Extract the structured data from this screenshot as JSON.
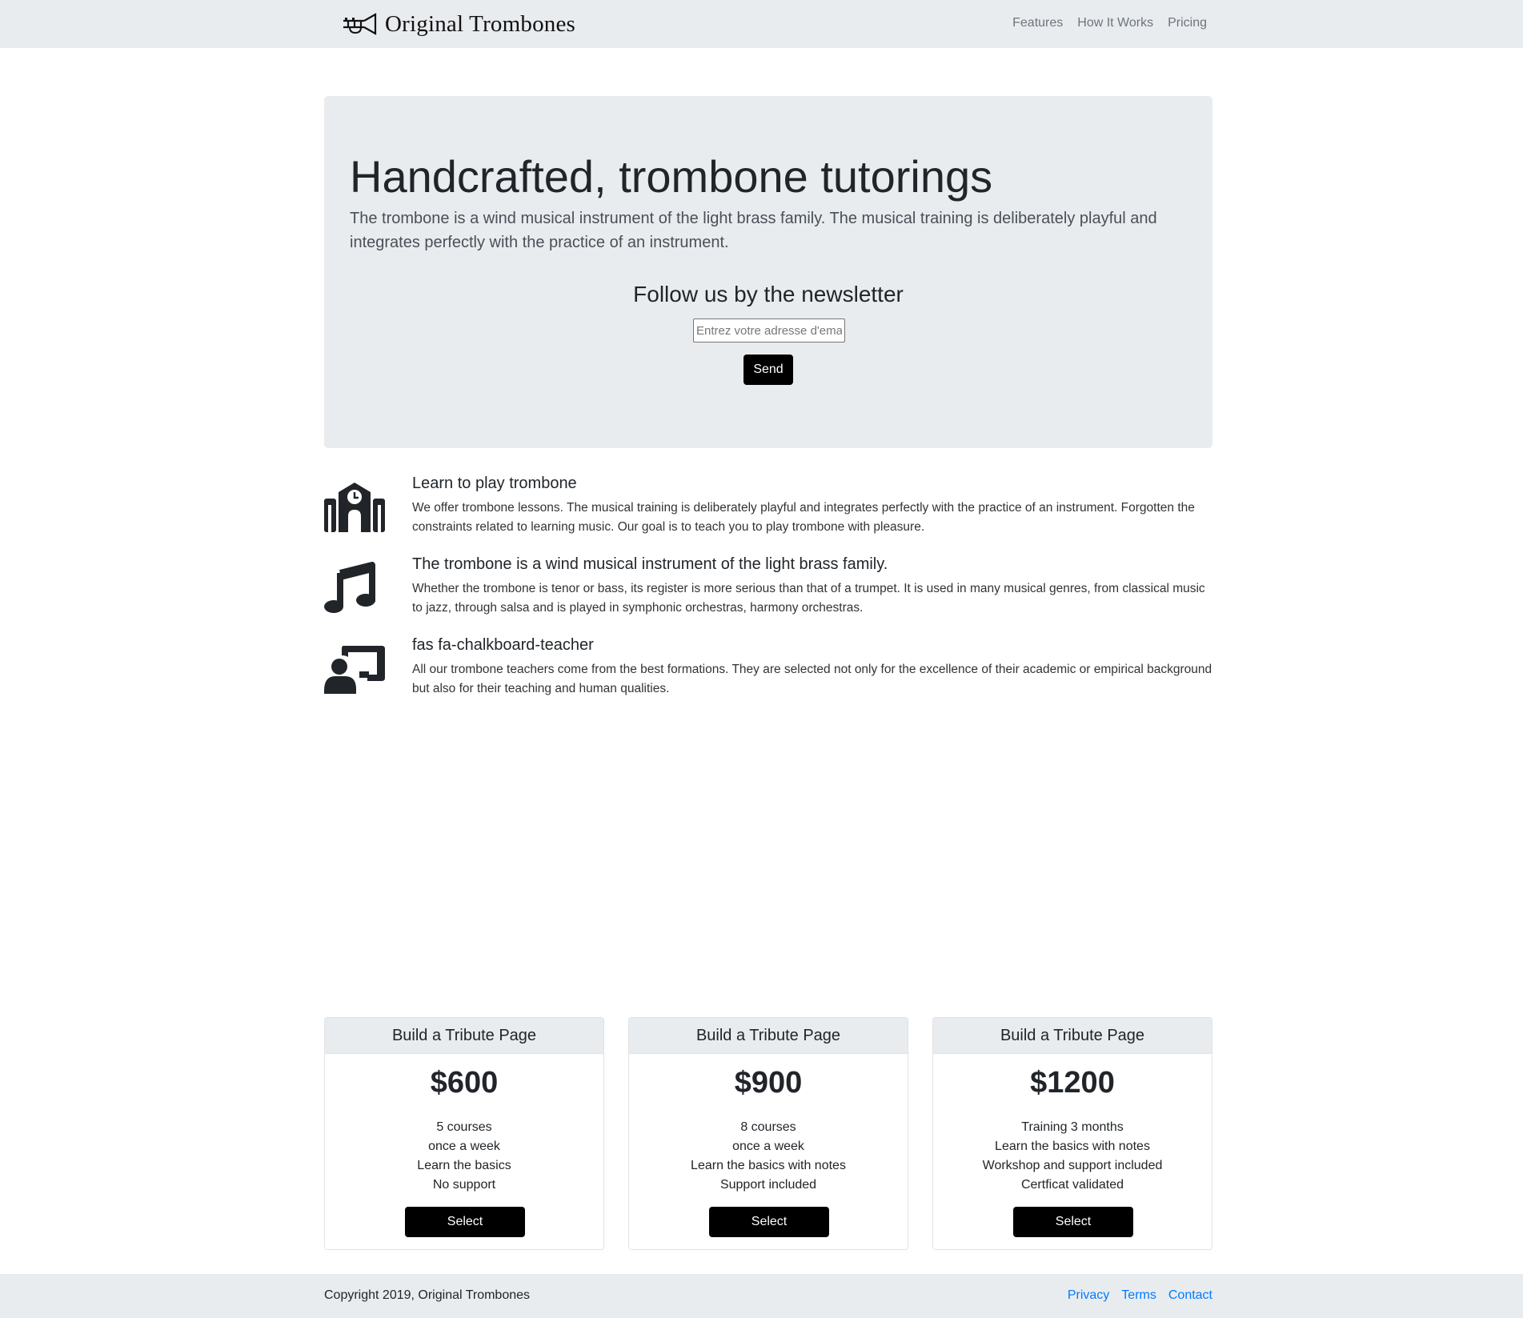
{
  "header": {
    "brand": "Original Trombones",
    "nav": [
      "Features",
      "How It Works",
      "Pricing"
    ]
  },
  "hero": {
    "title": "Handcrafted, trombone tutorings",
    "lead": "The trombone is a wind musical instrument of the light brass family. The musical training is deliberately playful and integrates perfectly with the practice of an instrument.",
    "newsletter_title": "Follow us by the newsletter",
    "email_placeholder": "Entrez votre adresse d'email",
    "send_label": "Send"
  },
  "features": [
    {
      "icon": "school-icon",
      "title": "Learn to play trombone",
      "text": "We offer trombone lessons. The musical training is deliberately playful and integrates perfectly with the practice of an instrument. Forgotten the constraints related to learning music. Our goal is to teach you to play trombone with pleasure."
    },
    {
      "icon": "music-note-icon",
      "title": "The trombone is a wind musical instrument of the light brass family.",
      "text": "Whether the trombone is tenor or bass, its register is more serious than that of a trumpet. It is used in many musical genres, from classical music to jazz, through salsa and is played in symphonic orchestras, harmony orchestras."
    },
    {
      "icon": "chalkboard-teacher-icon",
      "title": "fas fa-chalkboard-teacher",
      "text": "All our trombone teachers come from the best formations. They are selected not only for the excellence of their academic or empirical background but also for their teaching and human qualities."
    }
  ],
  "pricing": [
    {
      "header": "Build a Tribute Page",
      "price": "$600",
      "items": [
        "5 courses",
        "once a week",
        "Learn the basics",
        "No support"
      ],
      "button": "Select"
    },
    {
      "header": "Build a Tribute Page",
      "price": "$900",
      "items": [
        "8 courses",
        "once a week",
        "Learn the basics with notes",
        "Support included"
      ],
      "button": "Select"
    },
    {
      "header": "Build a Tribute Page",
      "price": "$1200",
      "items": [
        "Training 3 months",
        "Learn the basics with notes",
        "Workshop and support included",
        "Certficat validated"
      ],
      "button": "Select"
    }
  ],
  "footer": {
    "copyright": "Copyright 2019, Original Trombones",
    "links": [
      "Privacy",
      "Terms",
      "Contact"
    ]
  },
  "colors": {
    "header_bg": "#e9ecef",
    "button_bg": "#000000",
    "link": "#007bff"
  }
}
